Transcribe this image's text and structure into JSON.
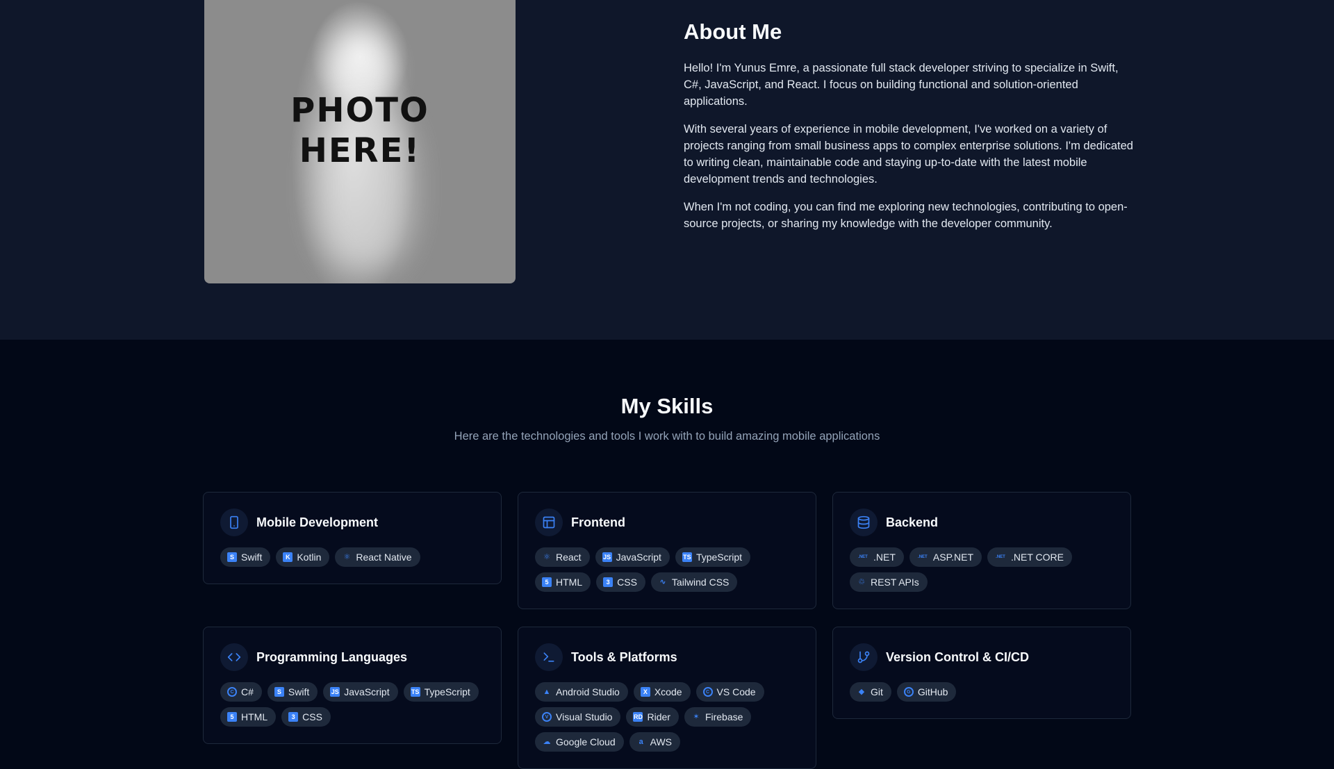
{
  "about": {
    "photo_text": "PHOTO\nHERE!",
    "heading": "About Me",
    "paragraphs": [
      "Hello! I'm Yunus Emre, a passionate full stack developer striving to specialize in Swift, C#, JavaScript, and React. I focus on building functional and solution-oriented applications.",
      "With several years of experience in mobile development, I've worked on a variety of projects ranging from small business apps to complex enterprise solutions. I'm dedicated to writing clean, maintainable code and staying up-to-date with the latest mobile development trends and technologies.",
      "When I'm not coding, you can find me exploring new technologies, contributing to open-source projects, or sharing my knowledge with the developer community."
    ]
  },
  "skills": {
    "heading": "My Skills",
    "subtitle": "Here are the technologies and tools I work with to build amazing mobile applications",
    "cards": [
      {
        "title": "Mobile Development",
        "icon": "smartphone-icon",
        "tags": [
          {
            "label": "Swift",
            "icon": "swift-icon"
          },
          {
            "label": "Kotlin",
            "icon": "kotlin-icon"
          },
          {
            "label": "React Native",
            "icon": "react-icon"
          }
        ]
      },
      {
        "title": "Frontend",
        "icon": "layout-icon",
        "tags": [
          {
            "label": "React",
            "icon": "react-icon"
          },
          {
            "label": "JavaScript",
            "icon": "javascript-icon"
          },
          {
            "label": "TypeScript",
            "icon": "typescript-icon"
          },
          {
            "label": "HTML",
            "icon": "html5-icon"
          },
          {
            "label": "CSS",
            "icon": "css3-icon"
          },
          {
            "label": "Tailwind CSS",
            "icon": "tailwind-icon"
          }
        ]
      },
      {
        "title": "Backend",
        "icon": "database-icon",
        "tags": [
          {
            "label": ".NET",
            "icon": "dotnet-icon"
          },
          {
            "label": "ASP.NET",
            "icon": "dotnet-icon"
          },
          {
            "label": ".NET CORE",
            "icon": "dotnet-icon"
          },
          {
            "label": "REST APIs",
            "icon": "api-icon"
          }
        ]
      },
      {
        "title": "Programming Languages",
        "icon": "code-icon",
        "tags": [
          {
            "label": "C#",
            "icon": "csharp-icon"
          },
          {
            "label": "Swift",
            "icon": "swift-icon"
          },
          {
            "label": "JavaScript",
            "icon": "javascript-icon"
          },
          {
            "label": "TypeScript",
            "icon": "typescript-icon"
          },
          {
            "label": "HTML",
            "icon": "html5-icon"
          },
          {
            "label": "CSS",
            "icon": "css3-icon"
          }
        ]
      },
      {
        "title": "Tools & Platforms",
        "icon": "terminal-icon",
        "tags": [
          {
            "label": "Android Studio",
            "icon": "android-studio-icon"
          },
          {
            "label": "Xcode",
            "icon": "xcode-icon"
          },
          {
            "label": "VS Code",
            "icon": "vscode-icon"
          },
          {
            "label": "Visual Studio",
            "icon": "visual-studio-icon"
          },
          {
            "label": "Rider",
            "icon": "rider-icon"
          },
          {
            "label": "Firebase",
            "icon": "firebase-icon"
          },
          {
            "label": "Google Cloud",
            "icon": "google-cloud-icon"
          },
          {
            "label": "AWS",
            "icon": "aws-icon"
          }
        ]
      },
      {
        "title": "Version Control & CI/CD",
        "icon": "git-branch-icon",
        "tags": [
          {
            "label": "Git",
            "icon": "git-icon"
          },
          {
            "label": "GitHub",
            "icon": "github-icon"
          }
        ]
      }
    ]
  },
  "colors": {
    "about_bg": "#0f172a",
    "page_bg": "#020817",
    "accent": "#3b82f6",
    "tag_bg": "#1e293b"
  }
}
